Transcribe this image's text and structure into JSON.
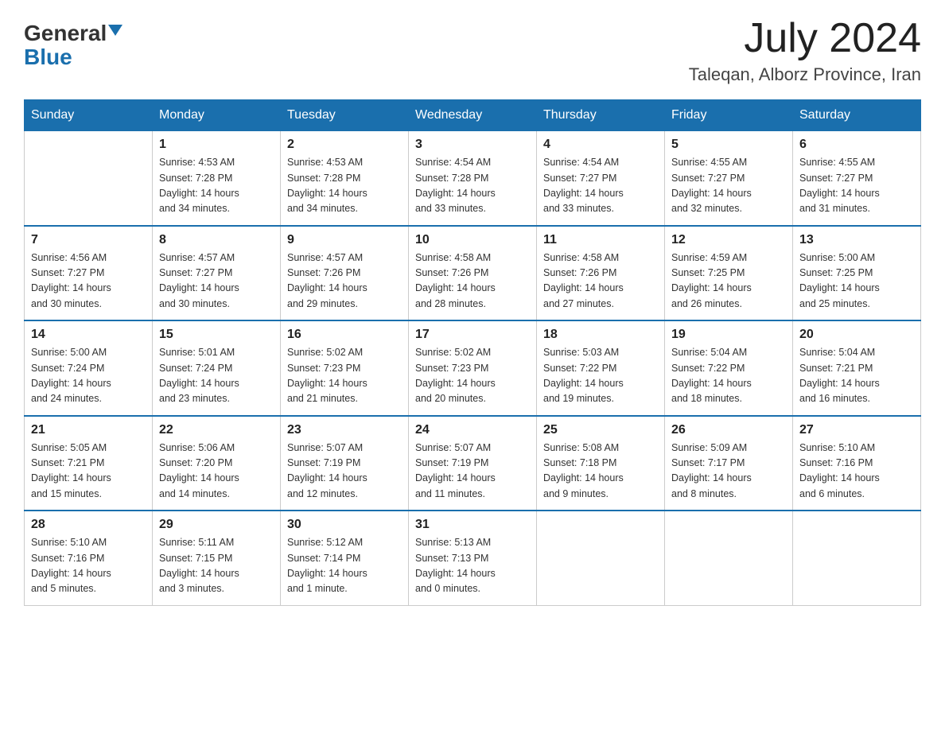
{
  "header": {
    "logo_general": "General",
    "logo_blue": "Blue",
    "month_year": "July 2024",
    "location": "Taleqan, Alborz Province, Iran"
  },
  "days_of_week": [
    "Sunday",
    "Monday",
    "Tuesday",
    "Wednesday",
    "Thursday",
    "Friday",
    "Saturday"
  ],
  "weeks": [
    [
      {
        "num": "",
        "info": ""
      },
      {
        "num": "1",
        "info": "Sunrise: 4:53 AM\nSunset: 7:28 PM\nDaylight: 14 hours\nand 34 minutes."
      },
      {
        "num": "2",
        "info": "Sunrise: 4:53 AM\nSunset: 7:28 PM\nDaylight: 14 hours\nand 34 minutes."
      },
      {
        "num": "3",
        "info": "Sunrise: 4:54 AM\nSunset: 7:28 PM\nDaylight: 14 hours\nand 33 minutes."
      },
      {
        "num": "4",
        "info": "Sunrise: 4:54 AM\nSunset: 7:27 PM\nDaylight: 14 hours\nand 33 minutes."
      },
      {
        "num": "5",
        "info": "Sunrise: 4:55 AM\nSunset: 7:27 PM\nDaylight: 14 hours\nand 32 minutes."
      },
      {
        "num": "6",
        "info": "Sunrise: 4:55 AM\nSunset: 7:27 PM\nDaylight: 14 hours\nand 31 minutes."
      }
    ],
    [
      {
        "num": "7",
        "info": "Sunrise: 4:56 AM\nSunset: 7:27 PM\nDaylight: 14 hours\nand 30 minutes."
      },
      {
        "num": "8",
        "info": "Sunrise: 4:57 AM\nSunset: 7:27 PM\nDaylight: 14 hours\nand 30 minutes."
      },
      {
        "num": "9",
        "info": "Sunrise: 4:57 AM\nSunset: 7:26 PM\nDaylight: 14 hours\nand 29 minutes."
      },
      {
        "num": "10",
        "info": "Sunrise: 4:58 AM\nSunset: 7:26 PM\nDaylight: 14 hours\nand 28 minutes."
      },
      {
        "num": "11",
        "info": "Sunrise: 4:58 AM\nSunset: 7:26 PM\nDaylight: 14 hours\nand 27 minutes."
      },
      {
        "num": "12",
        "info": "Sunrise: 4:59 AM\nSunset: 7:25 PM\nDaylight: 14 hours\nand 26 minutes."
      },
      {
        "num": "13",
        "info": "Sunrise: 5:00 AM\nSunset: 7:25 PM\nDaylight: 14 hours\nand 25 minutes."
      }
    ],
    [
      {
        "num": "14",
        "info": "Sunrise: 5:00 AM\nSunset: 7:24 PM\nDaylight: 14 hours\nand 24 minutes."
      },
      {
        "num": "15",
        "info": "Sunrise: 5:01 AM\nSunset: 7:24 PM\nDaylight: 14 hours\nand 23 minutes."
      },
      {
        "num": "16",
        "info": "Sunrise: 5:02 AM\nSunset: 7:23 PM\nDaylight: 14 hours\nand 21 minutes."
      },
      {
        "num": "17",
        "info": "Sunrise: 5:02 AM\nSunset: 7:23 PM\nDaylight: 14 hours\nand 20 minutes."
      },
      {
        "num": "18",
        "info": "Sunrise: 5:03 AM\nSunset: 7:22 PM\nDaylight: 14 hours\nand 19 minutes."
      },
      {
        "num": "19",
        "info": "Sunrise: 5:04 AM\nSunset: 7:22 PM\nDaylight: 14 hours\nand 18 minutes."
      },
      {
        "num": "20",
        "info": "Sunrise: 5:04 AM\nSunset: 7:21 PM\nDaylight: 14 hours\nand 16 minutes."
      }
    ],
    [
      {
        "num": "21",
        "info": "Sunrise: 5:05 AM\nSunset: 7:21 PM\nDaylight: 14 hours\nand 15 minutes."
      },
      {
        "num": "22",
        "info": "Sunrise: 5:06 AM\nSunset: 7:20 PM\nDaylight: 14 hours\nand 14 minutes."
      },
      {
        "num": "23",
        "info": "Sunrise: 5:07 AM\nSunset: 7:19 PM\nDaylight: 14 hours\nand 12 minutes."
      },
      {
        "num": "24",
        "info": "Sunrise: 5:07 AM\nSunset: 7:19 PM\nDaylight: 14 hours\nand 11 minutes."
      },
      {
        "num": "25",
        "info": "Sunrise: 5:08 AM\nSunset: 7:18 PM\nDaylight: 14 hours\nand 9 minutes."
      },
      {
        "num": "26",
        "info": "Sunrise: 5:09 AM\nSunset: 7:17 PM\nDaylight: 14 hours\nand 8 minutes."
      },
      {
        "num": "27",
        "info": "Sunrise: 5:10 AM\nSunset: 7:16 PM\nDaylight: 14 hours\nand 6 minutes."
      }
    ],
    [
      {
        "num": "28",
        "info": "Sunrise: 5:10 AM\nSunset: 7:16 PM\nDaylight: 14 hours\nand 5 minutes."
      },
      {
        "num": "29",
        "info": "Sunrise: 5:11 AM\nSunset: 7:15 PM\nDaylight: 14 hours\nand 3 minutes."
      },
      {
        "num": "30",
        "info": "Sunrise: 5:12 AM\nSunset: 7:14 PM\nDaylight: 14 hours\nand 1 minute."
      },
      {
        "num": "31",
        "info": "Sunrise: 5:13 AM\nSunset: 7:13 PM\nDaylight: 14 hours\nand 0 minutes."
      },
      {
        "num": "",
        "info": ""
      },
      {
        "num": "",
        "info": ""
      },
      {
        "num": "",
        "info": ""
      }
    ]
  ]
}
